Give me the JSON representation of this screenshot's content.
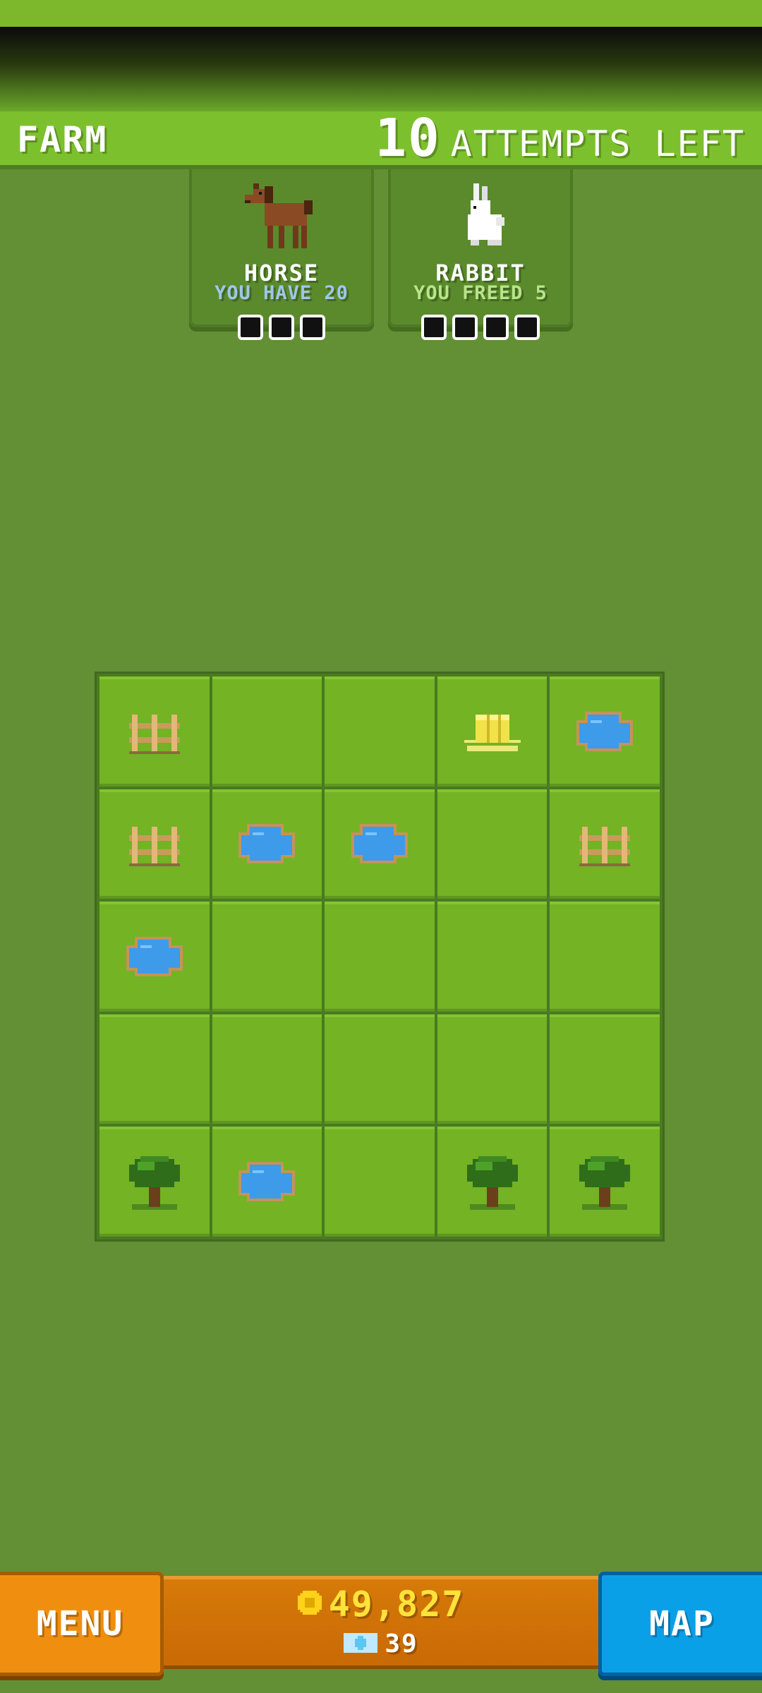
{
  "header": {
    "level_name": "FARM",
    "attempts_count": "10",
    "attempts_label": "ATTEMPTS LEFT"
  },
  "targets": [
    {
      "name": "HORSE",
      "status": "YOU HAVE 20",
      "slots": 3,
      "icon": "horse-icon",
      "status_color": "#9fc7e8"
    },
    {
      "name": "RABBIT",
      "status": "YOU FREED 5",
      "slots": 4,
      "icon": "rabbit-icon",
      "status_color": "#b8e48a"
    }
  ],
  "board": {
    "rows": [
      [
        "fence",
        "grass",
        "grass",
        "hay",
        "pond"
      ],
      [
        "fence",
        "pond",
        "pond",
        "grass",
        "fence"
      ],
      [
        "pond",
        "grass",
        "grass",
        "grass",
        "grass"
      ],
      [
        "grass",
        "grass",
        "grass",
        "grass",
        "grass"
      ],
      [
        "tree",
        "pond",
        "grass",
        "tree",
        "tree"
      ]
    ]
  },
  "footer": {
    "menu_label": "MENU",
    "coins": "49,827",
    "gems": "39",
    "map_label": "MAP"
  },
  "colors": {
    "background": "#638f35",
    "tile": "#73b324",
    "menu": "#f08f0f",
    "map": "#0aa0e8",
    "coins": "#ffe23a"
  }
}
